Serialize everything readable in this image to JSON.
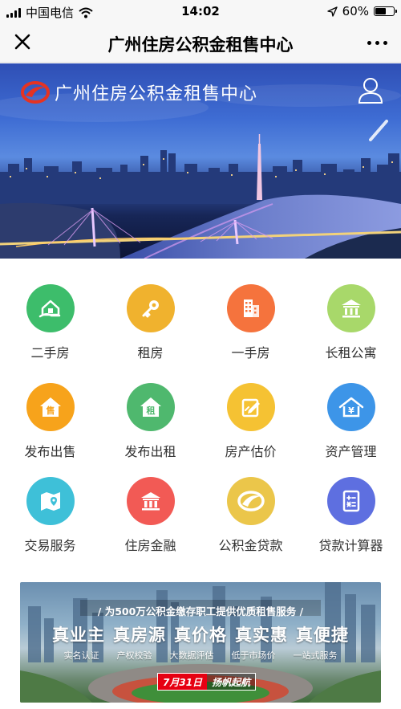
{
  "status_bar": {
    "carrier": "中国电信",
    "time": "14:02",
    "battery": "60%",
    "battery_level": 0.6
  },
  "nav_bar": {
    "title": "广州住房公积金租售中心",
    "close_icon": "close-icon",
    "more_icon": "more-dots-icon"
  },
  "hero": {
    "title": "广州住房公积金租售中心",
    "logo_icon": "logo-icon",
    "user_icon": "user-icon"
  },
  "services": [
    {
      "label": "二手房",
      "icon": "house-hand-icon",
      "color": "#3dbd6b"
    },
    {
      "label": "租房",
      "icon": "key-icon",
      "color": "#f0b22e"
    },
    {
      "label": "一手房",
      "icon": "building-icon",
      "color": "#f5733d"
    },
    {
      "label": "长租公寓",
      "icon": "bank-icon",
      "color": "#a8d86a"
    },
    {
      "label": "发布出售",
      "icon": "sale-house-icon",
      "color": "#f7a31b"
    },
    {
      "label": "发布出租",
      "icon": "rent-house-icon",
      "color": "#4fb86e"
    },
    {
      "label": "房产估价",
      "icon": "edit-icon",
      "color": "#f5c233"
    },
    {
      "label": "资产管理",
      "icon": "yen-house-icon",
      "color": "#3d95e8"
    },
    {
      "label": "交易服务",
      "icon": "map-pin-icon",
      "color": "#3ec0d8"
    },
    {
      "label": "住房金融",
      "icon": "bank-building-icon",
      "color": "#f25a55"
    },
    {
      "label": "公积金贷款",
      "icon": "fund-logo-icon",
      "color": "#ebc64a"
    },
    {
      "label": "贷款计算器",
      "icon": "calculator-icon",
      "color": "#5e6fe0"
    }
  ],
  "service_glyphs": {
    "sale": "售",
    "rent": "租",
    "yen": "¥"
  },
  "promo": {
    "tagline": "/ 为500万公积金缴存职工提供优质租售服务 /",
    "slogans": [
      "真业主",
      "真房源",
      "真价格",
      "真实惠",
      "真便捷"
    ],
    "subs": [
      "实名认证",
      "产权校验",
      "大数据评估",
      "低于市场价",
      "一站式服务"
    ],
    "date": "7月31日",
    "launch": "扬帆起航"
  }
}
